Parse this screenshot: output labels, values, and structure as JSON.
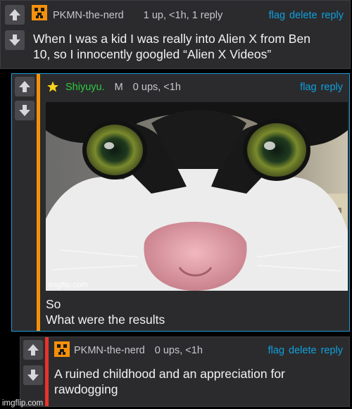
{
  "colors": {
    "link": "#0fa0dc",
    "username_green": "#2ecc40",
    "accent_orange": "#f5900a",
    "accent_red": "#e8332b",
    "border_blue": "#1b9bd8"
  },
  "comments": [
    {
      "username": "PKMN-the-nerd",
      "meta": "1 up, <1h, 1 reply",
      "actions": [
        "flag",
        "delete",
        "reply"
      ],
      "text_lines": [
        "When I was a kid I was really into Alien X from Ben",
        "10, so I innocently googled “Alien X Videos”"
      ]
    },
    {
      "username": "Shiyuyu.",
      "badge": "M",
      "meta": "0 ups, <1h",
      "actions": [
        "flag",
        "reply"
      ],
      "image_watermark": "imgflip.com",
      "text_lines": [
        "So",
        "What were the results"
      ]
    },
    {
      "username": "PKMN-the-nerd",
      "meta": "0 ups, <1h",
      "actions": [
        "flag",
        "delete",
        "reply"
      ],
      "text_lines": [
        "A ruined childhood and an appreciation for",
        "rawdogging"
      ]
    }
  ],
  "footer_watermark": "imgflip.com"
}
